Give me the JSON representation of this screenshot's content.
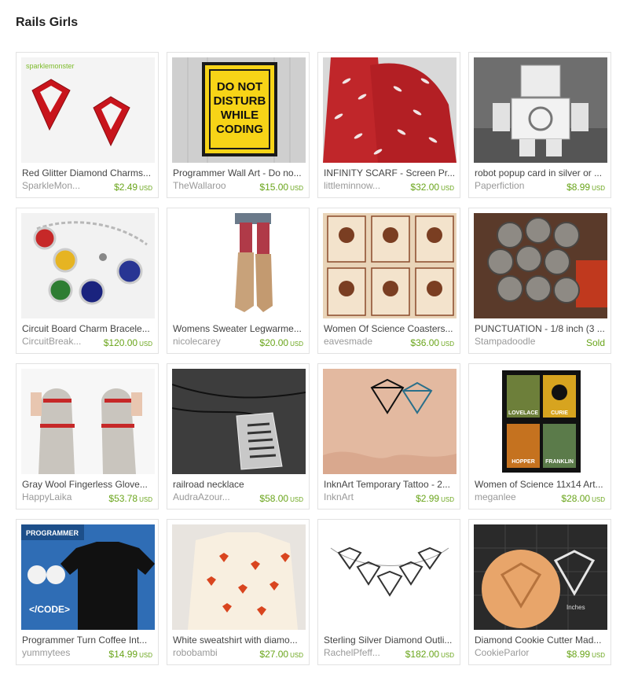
{
  "page": {
    "title": "Rails Girls"
  },
  "items": [
    {
      "name": "Red Glitter Diamond Charms...",
      "shop": "SparkleMon...",
      "price": "$2.49",
      "currency": "USD",
      "thumb_text": "sparklemonster"
    },
    {
      "name": "Programmer Wall Art - Do no...",
      "shop": "TheWallaroo",
      "price": "$15.00",
      "currency": "USD",
      "thumb_text": "DO NOT DISTURB WHILE CODING"
    },
    {
      "name": "INFINITY SCARF - Screen Pr...",
      "shop": "littleminnow...",
      "price": "$32.00",
      "currency": "USD"
    },
    {
      "name": "robot popup card in silver or ...",
      "shop": "Paperfiction",
      "price": "$8.99",
      "currency": "USD"
    },
    {
      "name": "Circuit Board Charm Bracele...",
      "shop": "CircuitBreak...",
      "price": "$120.00",
      "currency": "USD"
    },
    {
      "name": "Womens Sweater Legwarme...",
      "shop": "nicolecarey",
      "price": "$20.00",
      "currency": "USD"
    },
    {
      "name": "Women Of Science Coasters...",
      "shop": "eavesmade",
      "price": "$36.00",
      "currency": "USD"
    },
    {
      "name": "PUNCTUATION - 1/8 inch (3 ...",
      "shop": "Stampadoodle",
      "price": "",
      "currency": "",
      "sold": "Sold"
    },
    {
      "name": "Gray Wool Fingerless Glove...",
      "shop": "HappyLaika",
      "price": "$53.78",
      "currency": "USD"
    },
    {
      "name": "railroad necklace",
      "shop": "AudraAzour...",
      "price": "$58.00",
      "currency": "USD"
    },
    {
      "name": "InknArt Temporary Tattoo - 2...",
      "shop": "InknArt",
      "price": "$2.99",
      "currency": "USD"
    },
    {
      "name": "Women of Science 11x14 Art...",
      "shop": "meganlee",
      "price": "$28.00",
      "currency": "USD",
      "thumb_text": [
        "LOVELACE",
        "CURIE",
        "HOPPER",
        "FRANKLIN"
      ]
    },
    {
      "name": "Programmer Turn Coffee Int...",
      "shop": "yummytees",
      "price": "$14.99",
      "currency": "USD",
      "thumb_text": [
        "PROGRAMMER",
        "</CODE>"
      ]
    },
    {
      "name": "White sweatshirt with diamo...",
      "shop": "robobambi",
      "price": "$27.00",
      "currency": "USD"
    },
    {
      "name": "Sterling Silver Diamond Outli...",
      "shop": "RachelPfeff...",
      "price": "$182.00",
      "currency": "USD"
    },
    {
      "name": "Diamond Cookie Cutter Mad...",
      "shop": "CookieParlor",
      "price": "$8.99",
      "currency": "USD",
      "thumb_text": "Inches"
    }
  ]
}
